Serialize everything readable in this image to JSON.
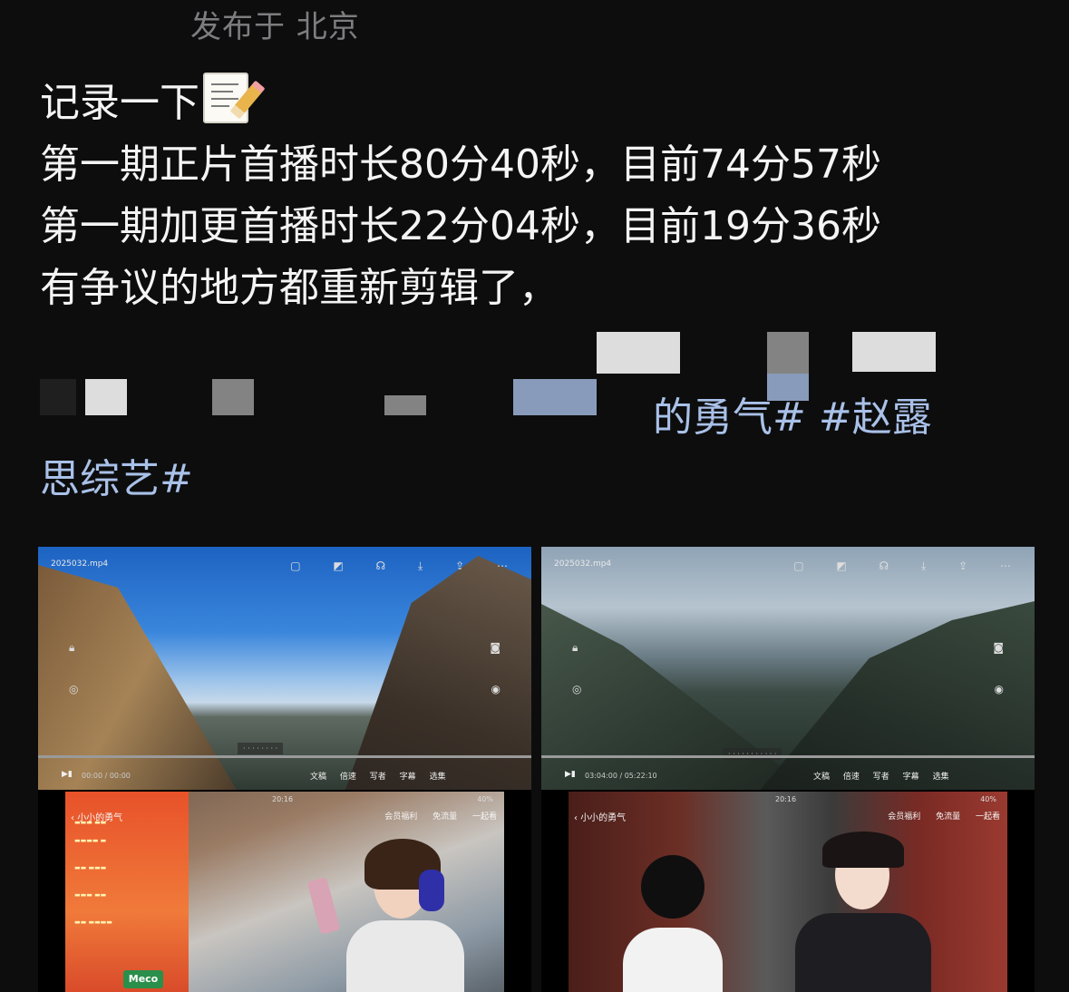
{
  "location": "发布于 北京",
  "post": {
    "line1": "记录一下",
    "memo_icon": "memo-icon",
    "line2": "第一期正片首播时长80分40秒，目前74分57秒",
    "line3": "第一期加更首播时长22分04秒，目前19分36秒",
    "line4_visible": "有争议的地方都重新剪辑了，",
    "tags_tail": "的勇气# #赵露",
    "tags_line3": "思综艺#"
  },
  "screenshot_left": {
    "file_name": "2025032",
    "file_ext": ".mp4",
    "player_icons": [
      "cast-icon",
      "danmaku-icon",
      "headphones-icon",
      "download-icon",
      "share-icon",
      "more-icon"
    ],
    "time": "00:00 / 00:00",
    "controls": [
      "文稿",
      "倍速",
      "写者",
      "字幕",
      "选集"
    ],
    "phone_clock": "20:16",
    "phone_battery": "40%",
    "app_title": "小小的勇气",
    "app_menu": [
      "会员福利",
      "免流量",
      "一起看"
    ],
    "brand": "Meco"
  },
  "screenshot_right": {
    "file_name": "2025032",
    "file_ext": ".mp4",
    "player_icons": [
      "cast-icon",
      "danmaku-icon",
      "headphones-icon",
      "download-icon",
      "share-icon",
      "more-icon"
    ],
    "time": "03:04:00 / 05:22:10",
    "controls": [
      "文稿",
      "倍速",
      "写者",
      "字幕",
      "选集"
    ],
    "phone_clock": "20:16",
    "phone_battery": "40%",
    "app_title": "小小的勇气",
    "app_menu": [
      "会员福利",
      "免流量",
      "一起看"
    ]
  },
  "colors": {
    "background": "#0d0d0e",
    "text": "#f4f4f4",
    "location": "#7d7d80",
    "hashtag": "#a9c1e8"
  }
}
